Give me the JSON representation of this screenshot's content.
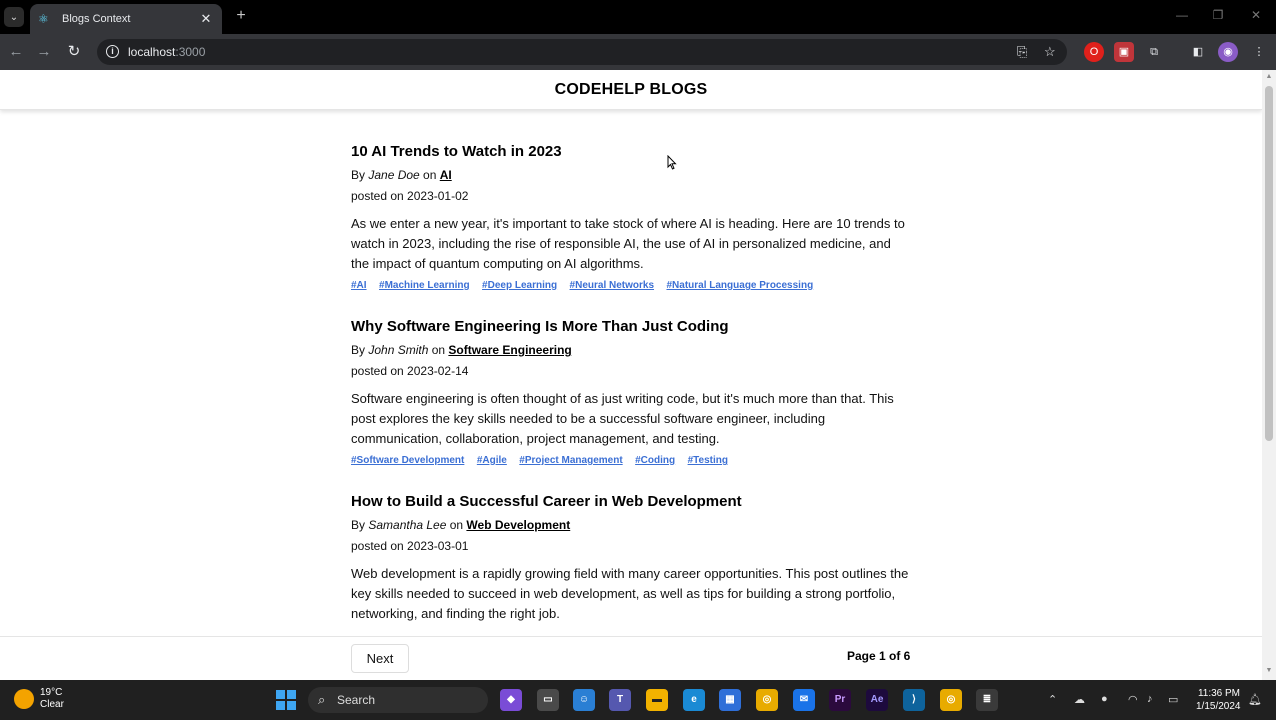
{
  "browser": {
    "tab_title": "Blogs Context",
    "tab_close": "✕",
    "new_tab": "+",
    "url_host": "localhost",
    "url_port": ":3000"
  },
  "site": {
    "title": "CODEHELP BLOGS"
  },
  "posts": [
    {
      "title": "10 AI Trends to Watch in 2023",
      "by": "By ",
      "author": "Jane Doe",
      "on": " on ",
      "category": "AI",
      "date": "posted on 2023-01-02",
      "excerpt": "As we enter a new year, it's important to take stock of where AI is heading. Here are 10 trends to watch in 2023, including the rise of responsible AI, the use of AI in personalized medicine, and the impact of quantum computing on AI algorithms.",
      "tags": [
        "#AI",
        "#Machine Learning",
        "#Deep Learning",
        "#Neural Networks",
        "#Natural Language Processing"
      ]
    },
    {
      "title": "Why Software Engineering Is More Than Just Coding",
      "by": "By ",
      "author": "John Smith",
      "on": " on ",
      "category": "Software Engineering",
      "date": "posted on 2023-02-14",
      "excerpt": "Software engineering is often thought of as just writing code, but it's much more than that. This post explores the key skills needed to be a successful software engineer, including communication, collaboration, project management, and testing.",
      "tags": [
        "#Software Development",
        "#Agile",
        "#Project Management",
        "#Coding",
        "#Testing"
      ]
    },
    {
      "title": "How to Build a Successful Career in Web Development",
      "by": "By ",
      "author": "Samantha Lee",
      "on": " on ",
      "category": "Web Development",
      "date": "posted on 2023-03-01",
      "excerpt": "Web development is a rapidly growing field with many career opportunities. This post outlines the key skills needed to succeed in web development, as well as tips for building a strong portfolio, networking, and finding the right job.",
      "tags": []
    }
  ],
  "pagination": {
    "next_label": "Next",
    "page_info": "Page 1 of 6"
  },
  "taskbar": {
    "temperature": "19°C",
    "weather": "Clear",
    "search_label": "Search",
    "time": "11:36 PM",
    "date": "1/15/2024",
    "notification_badge": "2"
  }
}
